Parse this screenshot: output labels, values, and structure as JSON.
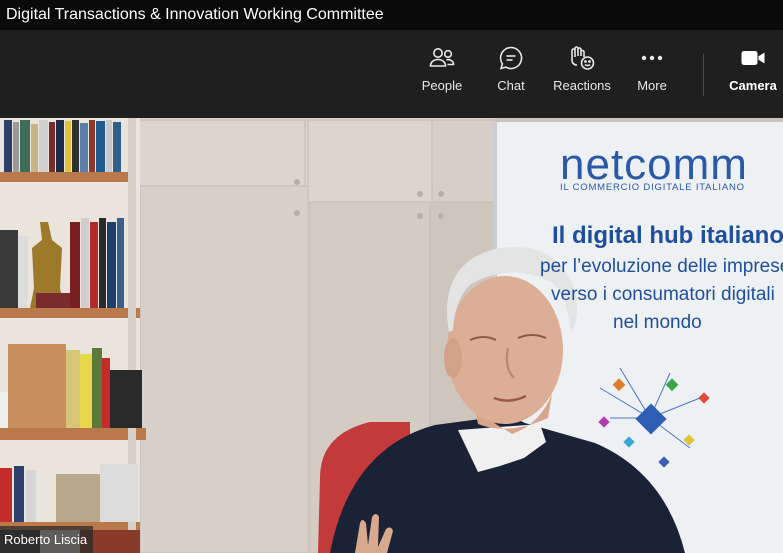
{
  "window": {
    "title": "Digital Transactions & Innovation Working Committee"
  },
  "toolbar": {
    "buttons": [
      {
        "label": "People",
        "icon": "people-icon"
      },
      {
        "label": "Chat",
        "icon": "chat-icon"
      },
      {
        "label": "Reactions",
        "icon": "reactions-icon"
      },
      {
        "label": "More",
        "icon": "more-icon"
      },
      {
        "label": "Camera",
        "icon": "camera-icon"
      }
    ]
  },
  "video": {
    "participant_name": "Roberto Liscia",
    "banner": {
      "logo": "netcomm",
      "tagline": "IL COMMERCIO DIGITALE ITALIANO",
      "headline": "Il digital hub italiano",
      "line2": "per l’evoluzione delle imprese",
      "line3": "verso i consumatori digitali",
      "line4": "nel mondo"
    }
  }
}
